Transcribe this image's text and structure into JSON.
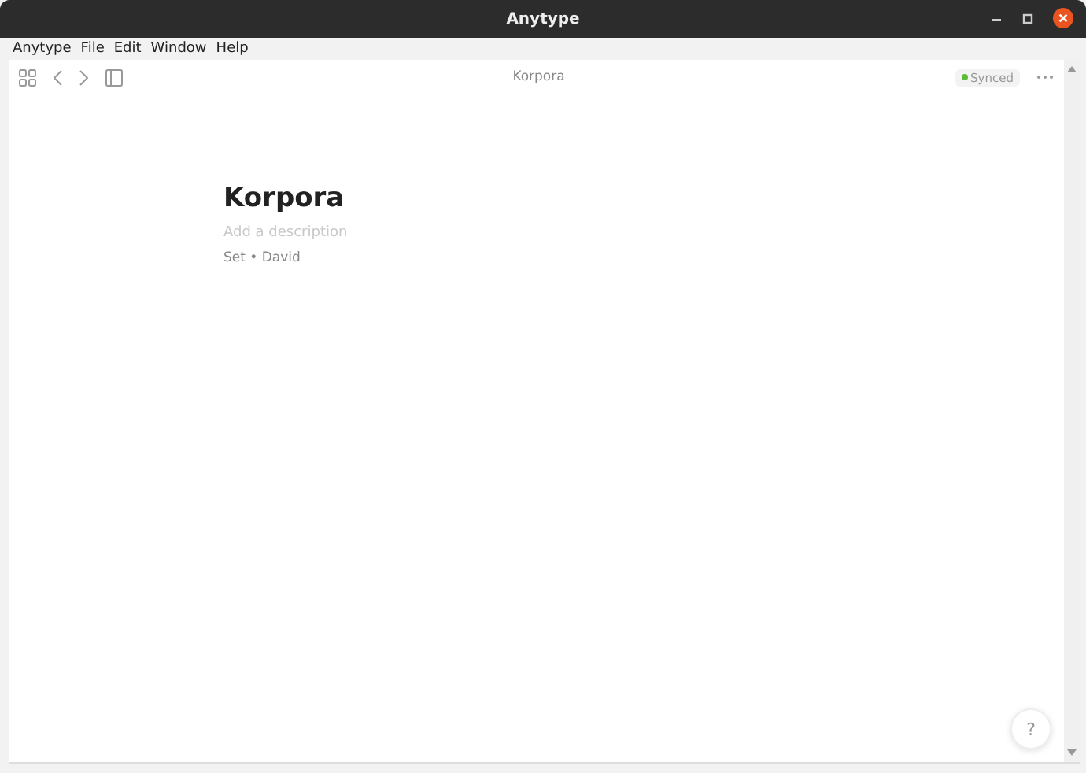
{
  "window": {
    "title": "Anytype"
  },
  "menu": [
    "Anytype",
    "File",
    "Edit",
    "Window",
    "Help"
  ],
  "toolbar": {
    "breadcrumb": "Korpora",
    "sync_status": "Synced"
  },
  "page": {
    "title": "Korpora",
    "description_placeholder": "Add a description",
    "meta": "Set • David"
  },
  "help_button": "?"
}
